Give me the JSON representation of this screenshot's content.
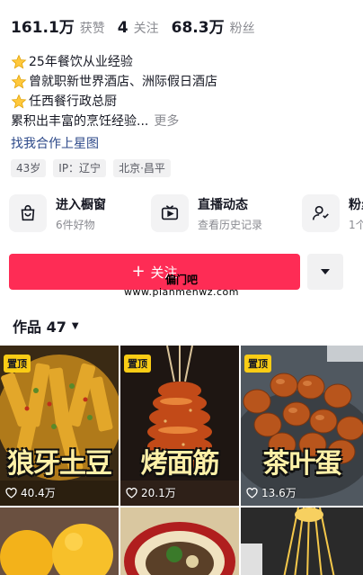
{
  "stats": [
    {
      "num": "161.1万",
      "label": "获赞"
    },
    {
      "num": "4",
      "label": "关注"
    },
    {
      "num": "68.3万",
      "label": "粉丝"
    }
  ],
  "bio": {
    "lines": [
      "25年餐饮从业经验",
      "曾就职新世界酒店、洲际假日酒店",
      "任西餐行政总厨"
    ],
    "summary": "累积出丰富的烹饪经验...",
    "more": "更多",
    "link": "找我合作上星图"
  },
  "tags": [
    "43岁",
    "IP：辽宁",
    "北京·昌平"
  ],
  "shortcuts": [
    {
      "title": "进入橱窗",
      "sub": "6件好物",
      "icon": "shopping-bag-icon"
    },
    {
      "title": "直播动态",
      "sub": "查看历史记录",
      "icon": "live-tv-icon"
    },
    {
      "title": "粉丝",
      "sub": "1个",
      "icon": "fans-group-icon"
    }
  ],
  "follow_label": "关注",
  "watermark": {
    "title": "偏门吧",
    "url": "www.pianmenwz.com"
  },
  "works": {
    "label": "作品 47"
  },
  "videos": [
    {
      "pin": "置顶",
      "caption": "狼牙土豆",
      "likes": "40.4万"
    },
    {
      "pin": "置顶",
      "caption": "烤面筋",
      "likes": "20.1万"
    },
    {
      "pin": "置顶",
      "caption": "茶叶蛋",
      "likes": "13.6万"
    },
    {
      "pin": "",
      "caption": "",
      "likes": ""
    },
    {
      "pin": "",
      "caption": "",
      "likes": ""
    },
    {
      "pin": "",
      "caption": "",
      "likes": ""
    }
  ],
  "colors": {
    "accent": "#fe2c55",
    "link": "#2e4a8a",
    "pin": "#facc15"
  }
}
